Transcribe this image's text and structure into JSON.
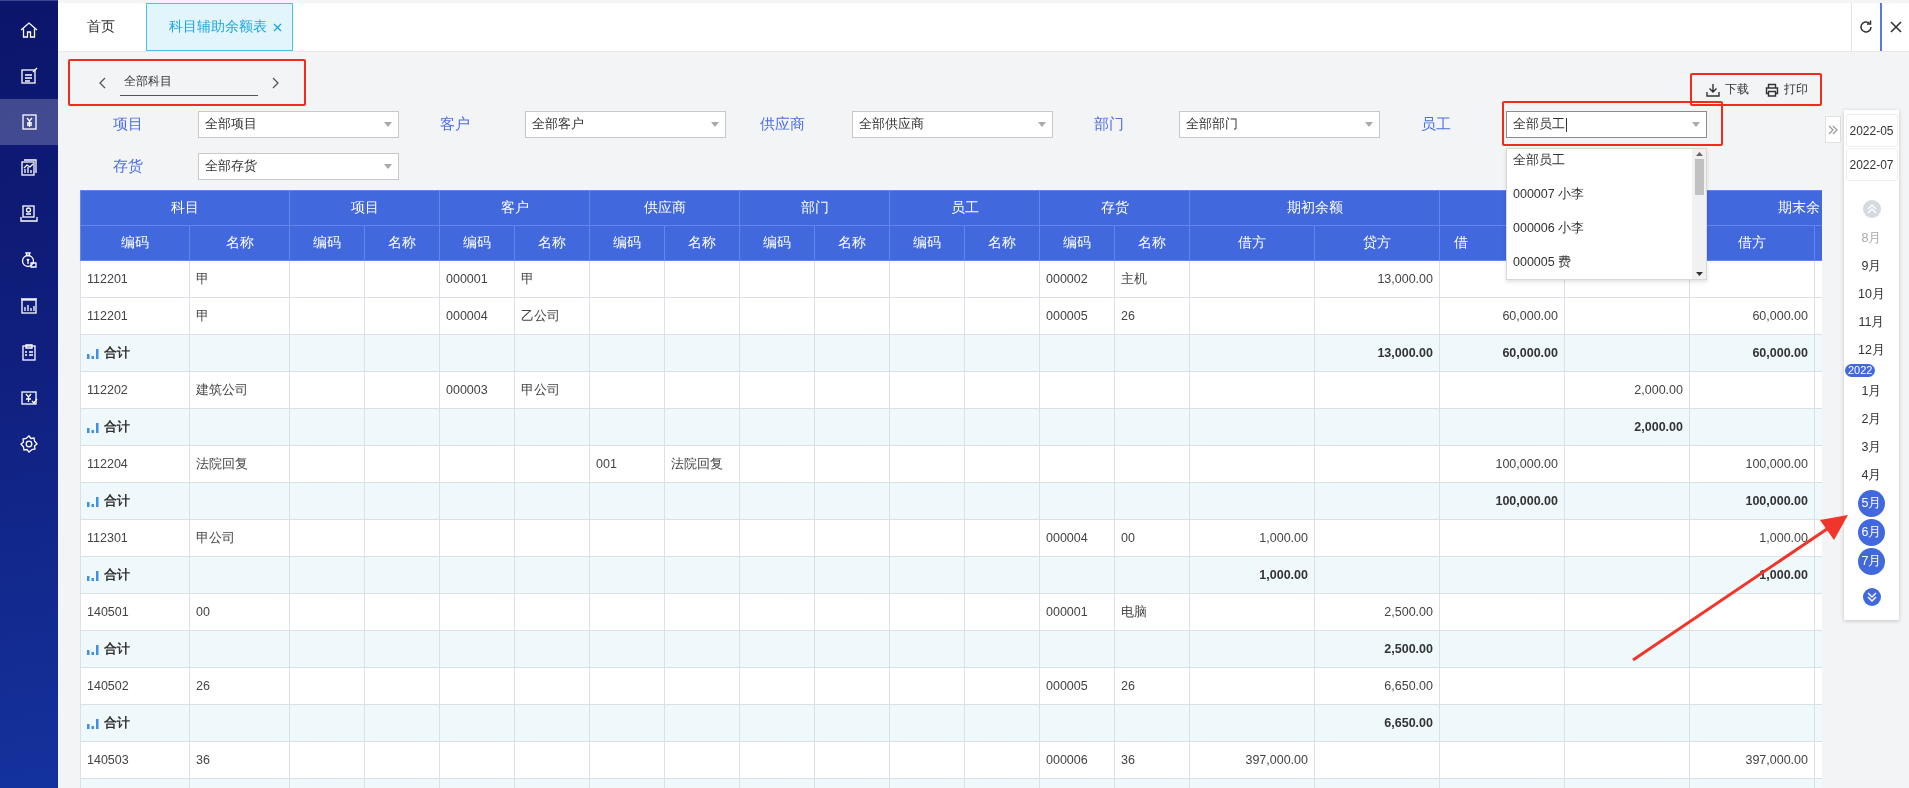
{
  "sidebar": {
    "items": [
      {
        "selected": false
      },
      {
        "selected": false
      },
      {
        "selected": true
      },
      {
        "selected": false
      },
      {
        "selected": false
      },
      {
        "selected": false
      },
      {
        "selected": false
      },
      {
        "selected": false
      },
      {
        "selected": false
      },
      {
        "selected": false
      }
    ]
  },
  "tabs": [
    {
      "label": "首页",
      "selected": false,
      "closable": false
    },
    {
      "label": "科目辅助余额表",
      "selected": true,
      "closable": true
    }
  ],
  "subject_nav": {
    "value": "全部科目",
    "highlighted": true
  },
  "toolbar": {
    "highlighted": true,
    "buttons": [
      {
        "label": "下载",
        "kind": "download"
      },
      {
        "label": "打印",
        "kind": "print"
      }
    ]
  },
  "filters": [
    {
      "label": "项目",
      "value": "全部项目",
      "highlighted": false,
      "focused": false
    },
    {
      "label": "客户",
      "value": "全部客户",
      "highlighted": false,
      "focused": false
    },
    {
      "label": "供应商",
      "value": "全部供应商",
      "highlighted": false,
      "focused": false
    },
    {
      "label": "部门",
      "value": "全部部门",
      "highlighted": false,
      "focused": false
    },
    {
      "label": "员工",
      "value": "全部员工",
      "highlighted": true,
      "focused": true,
      "options": [
        "全部员工",
        "000007 小李",
        "000006 小李",
        "000005 费"
      ]
    },
    {
      "label": "存货",
      "value": "全部存货",
      "highlighted": false,
      "focused": false
    }
  ],
  "table": {
    "groups": [
      {
        "label": "科目",
        "kind": "text",
        "columns": [
          {
            "label": "编码"
          },
          {
            "label": "名称"
          }
        ]
      },
      {
        "label": "项目",
        "kind": "text",
        "columns": [
          {
            "label": "编码"
          },
          {
            "label": "名称"
          }
        ]
      },
      {
        "label": "客户",
        "kind": "text",
        "columns": [
          {
            "label": "编码"
          },
          {
            "label": "名称"
          }
        ]
      },
      {
        "label": "供应商",
        "kind": "text",
        "columns": [
          {
            "label": "编码"
          },
          {
            "label": "名称"
          }
        ]
      },
      {
        "label": "部门",
        "kind": "text",
        "columns": [
          {
            "label": "编码"
          },
          {
            "label": "名称"
          }
        ]
      },
      {
        "label": "员工",
        "kind": "text",
        "columns": [
          {
            "label": "编码"
          },
          {
            "label": "名称"
          }
        ]
      },
      {
        "label": "存货",
        "kind": "text",
        "columns": [
          {
            "label": "编码"
          },
          {
            "label": "名称"
          }
        ]
      },
      {
        "label": "期初余额",
        "kind": "amount",
        "columns": [
          {
            "label": "借方"
          },
          {
            "label": "贷方"
          }
        ]
      },
      {
        "kind": "amount",
        "columns": [
          {
            "label": "借",
            "cut": true
          },
          {}
        ]
      },
      {
        "label": "期末余",
        "cut": true,
        "kind": "amount",
        "columns": [
          {
            "label": "借方"
          },
          {
            "kind": "edge"
          }
        ]
      }
    ],
    "rows": [
      {
        "kind": "data",
        "cells": [
          "112201",
          "甲",
          null,
          null,
          "000001",
          "甲",
          null,
          null,
          null,
          null,
          null,
          null,
          "000002",
          "主机",
          null,
          "13,000.00",
          null,
          null,
          null,
          null
        ]
      },
      {
        "kind": "data",
        "cells": [
          "112201",
          "甲",
          null,
          null,
          "000004",
          "乙公司",
          null,
          null,
          null,
          null,
          null,
          null,
          "000005",
          "26",
          null,
          null,
          "60,000.00",
          null,
          "60,000.00",
          null
        ]
      },
      {
        "kind": "summary",
        "cells": [
          "合计",
          null,
          null,
          null,
          null,
          null,
          null,
          null,
          null,
          null,
          null,
          null,
          null,
          null,
          null,
          "13,000.00",
          "60,000.00",
          null,
          "60,000.00",
          null
        ]
      },
      {
        "kind": "data",
        "cells": [
          "112202",
          "建筑公司",
          null,
          null,
          "000003",
          "甲公司",
          null,
          null,
          null,
          null,
          null,
          null,
          null,
          null,
          null,
          null,
          null,
          "2,000.00",
          null,
          null
        ]
      },
      {
        "kind": "summary",
        "cells": [
          "合计",
          null,
          null,
          null,
          null,
          null,
          null,
          null,
          null,
          null,
          null,
          null,
          null,
          null,
          null,
          null,
          null,
          "2,000.00",
          null,
          null
        ]
      },
      {
        "kind": "data",
        "cells": [
          "112204",
          "法院回复",
          null,
          null,
          null,
          null,
          "001",
          "法院回复",
          null,
          null,
          null,
          null,
          null,
          null,
          null,
          null,
          "100,000.00",
          null,
          "100,000.00",
          null
        ]
      },
      {
        "kind": "summary",
        "cells": [
          "合计",
          null,
          null,
          null,
          null,
          null,
          null,
          null,
          null,
          null,
          null,
          null,
          null,
          null,
          null,
          null,
          "100,000.00",
          null,
          "100,000.00",
          null
        ]
      },
      {
        "kind": "data",
        "cells": [
          "112301",
          "甲公司",
          null,
          null,
          null,
          null,
          null,
          null,
          null,
          null,
          null,
          null,
          "000004",
          "00",
          "1,000.00",
          null,
          null,
          null,
          "1,000.00",
          null
        ]
      },
      {
        "kind": "summary",
        "cells": [
          "合计",
          null,
          null,
          null,
          null,
          null,
          null,
          null,
          null,
          null,
          null,
          null,
          null,
          null,
          "1,000.00",
          null,
          null,
          null,
          "1,000.00",
          null
        ]
      },
      {
        "kind": "data",
        "cells": [
          "140501",
          "00",
          null,
          null,
          null,
          null,
          null,
          null,
          null,
          null,
          null,
          null,
          "000001",
          "电脑",
          null,
          "2,500.00",
          null,
          null,
          null,
          null
        ]
      },
      {
        "kind": "summary",
        "cells": [
          "合计",
          null,
          null,
          null,
          null,
          null,
          null,
          null,
          null,
          null,
          null,
          null,
          null,
          null,
          null,
          "2,500.00",
          null,
          null,
          null,
          null
        ]
      },
      {
        "kind": "data",
        "cells": [
          "140502",
          "26",
          null,
          null,
          null,
          null,
          null,
          null,
          null,
          null,
          null,
          null,
          "000005",
          "26",
          null,
          "6,650.00",
          null,
          null,
          null,
          null
        ]
      },
      {
        "kind": "summary",
        "cells": [
          "合计",
          null,
          null,
          null,
          null,
          null,
          null,
          null,
          null,
          null,
          null,
          null,
          null,
          null,
          null,
          "6,650.00",
          null,
          null,
          null,
          null
        ]
      },
      {
        "kind": "data",
        "cells": [
          "140503",
          "36",
          null,
          null,
          null,
          null,
          null,
          null,
          null,
          null,
          null,
          null,
          "000006",
          "36",
          "397,000.00",
          null,
          null,
          null,
          "397,000.00",
          null
        ]
      }
    ]
  },
  "period_panel": {
    "range_start": "2022-05",
    "range_end": "2022-07",
    "items": [
      {
        "kind": "month",
        "label": "8月",
        "selected": false,
        "disabled": true
      },
      {
        "kind": "month",
        "label": "9月",
        "selected": false,
        "disabled": false
      },
      {
        "kind": "month",
        "label": "10月",
        "selected": false,
        "disabled": false
      },
      {
        "kind": "month",
        "label": "11月",
        "selected": false,
        "disabled": false
      },
      {
        "kind": "month",
        "label": "12月",
        "selected": false,
        "disabled": false
      },
      {
        "kind": "year",
        "label": "2022"
      },
      {
        "kind": "month",
        "label": "1月",
        "selected": false,
        "disabled": false
      },
      {
        "kind": "month",
        "label": "2月",
        "selected": false,
        "disabled": false
      },
      {
        "kind": "month",
        "label": "3月",
        "selected": false,
        "disabled": false
      },
      {
        "kind": "month",
        "label": "4月",
        "selected": false,
        "disabled": false
      },
      {
        "kind": "month",
        "label": "5月",
        "selected": true,
        "disabled": false
      },
      {
        "kind": "month",
        "label": "6月",
        "selected": true,
        "disabled": false
      },
      {
        "kind": "month",
        "label": "7月",
        "selected": true,
        "disabled": false
      }
    ]
  }
}
